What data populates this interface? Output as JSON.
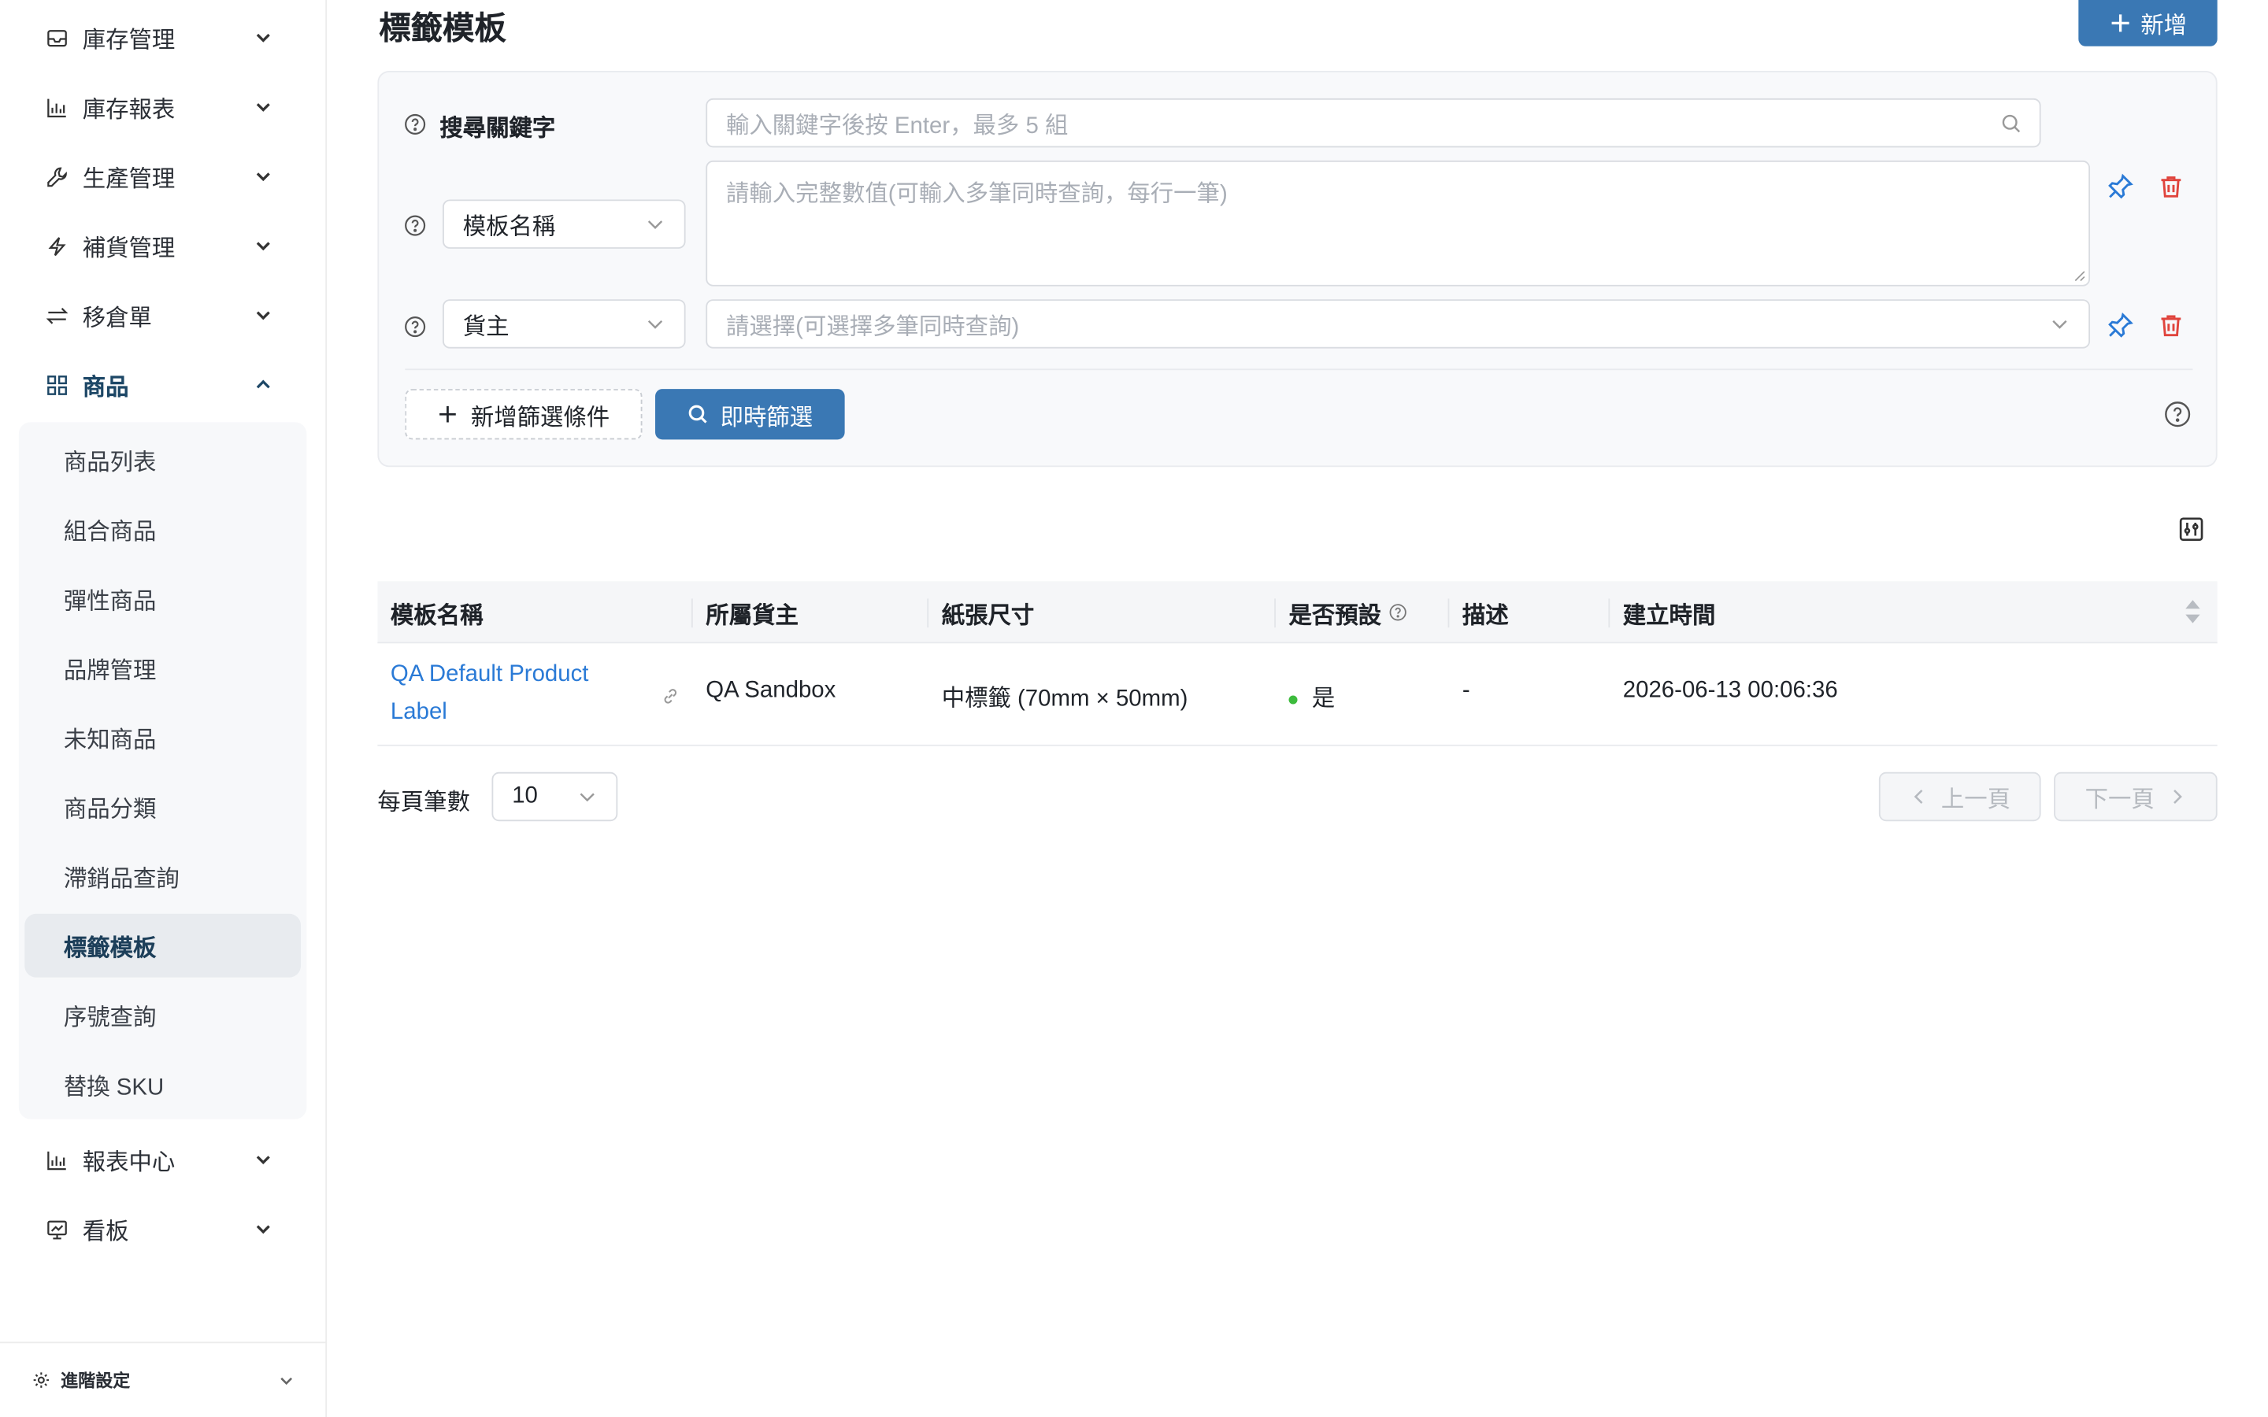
{
  "sidebar": {
    "items": [
      {
        "label": "庫存管理",
        "icon": "inbox-icon"
      },
      {
        "label": "庫存報表",
        "icon": "bar-chart-icon"
      },
      {
        "label": "生產管理",
        "icon": "wrench-icon"
      },
      {
        "label": "補貨管理",
        "icon": "lightning-icon"
      },
      {
        "label": "移倉單",
        "icon": "swap-icon"
      },
      {
        "label": "商品",
        "icon": "grid-icon"
      },
      {
        "label": "報表中心",
        "icon": "bar-chart-icon"
      },
      {
        "label": "看板",
        "icon": "dashboard-icon"
      }
    ],
    "sub_items": [
      "商品列表",
      "組合商品",
      "彈性商品",
      "品牌管理",
      "未知商品",
      "商品分類",
      "滯銷品查詢",
      "標籤模板",
      "序號查詢",
      "替換 SKU"
    ],
    "active_sub": "標籤模板",
    "advanced_label": "進階設定"
  },
  "header": {
    "title": "標籤模板",
    "add_label": "新增"
  },
  "filters": {
    "keyword_label": "搜尋關鍵字",
    "keyword_placeholder": "輸入關鍵字後按 Enter，最多 5 組",
    "field1_select": "模板名稱",
    "field1_placeholder": "請輸入完整數值(可輸入多筆同時查詢，每行一筆)",
    "field2_select": "貨主",
    "field2_placeholder": "請選擇(可選擇多筆同時查詢)",
    "add_filter_label": "新增篩選條件",
    "instant_filter_label": "即時篩選"
  },
  "table": {
    "columns": [
      "模板名稱",
      "所屬貨主",
      "紙張尺寸",
      "是否預設",
      "描述",
      "建立時間"
    ],
    "rows": [
      {
        "name": "QA Default Product Label",
        "owner": "QA Sandbox",
        "paper": "中標籤 (70mm × 50mm)",
        "is_default": "是",
        "description": "-",
        "created_at": "2026-06-13 00:06:36"
      }
    ]
  },
  "pager": {
    "page_size_label": "每頁筆數",
    "page_size": "10",
    "prev_label": "上一頁",
    "next_label": "下一頁"
  },
  "colors": {
    "primary": "#3a78b4",
    "link": "#2a7ad6",
    "danger": "#e0443c",
    "success": "#3dbb3d"
  }
}
